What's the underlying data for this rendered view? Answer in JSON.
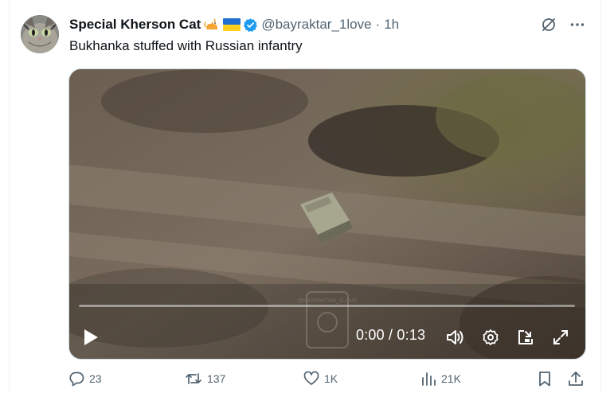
{
  "tweet": {
    "display_name": "Special Kherson Cat",
    "emojis": [
      "cat-emoji",
      "ukraine-flag-emoji"
    ],
    "verified": true,
    "handle": "@bayraktar_1love",
    "separator": "·",
    "time": "1h",
    "text": "Bukhanka stuffed with Russian infantry"
  },
  "video": {
    "timecode": "0:00 / 0:13",
    "progress": 0,
    "watermark_text": "@BAYRAKTAR_1LOVE"
  },
  "actions": {
    "replies": "23",
    "reposts": "137",
    "likes": "1K",
    "views": "21K"
  },
  "colors": {
    "text": "#0f1419",
    "secondary": "#536471",
    "verified_blue": "#1d9bf0",
    "border": "#cfd9de"
  },
  "icons": [
    "grok-icon",
    "more-icon",
    "play-icon",
    "volume-icon",
    "settings-icon",
    "pip-icon",
    "fullscreen-icon",
    "reply-icon",
    "repost-icon",
    "like-icon",
    "views-icon",
    "bookmark-icon",
    "share-icon"
  ]
}
